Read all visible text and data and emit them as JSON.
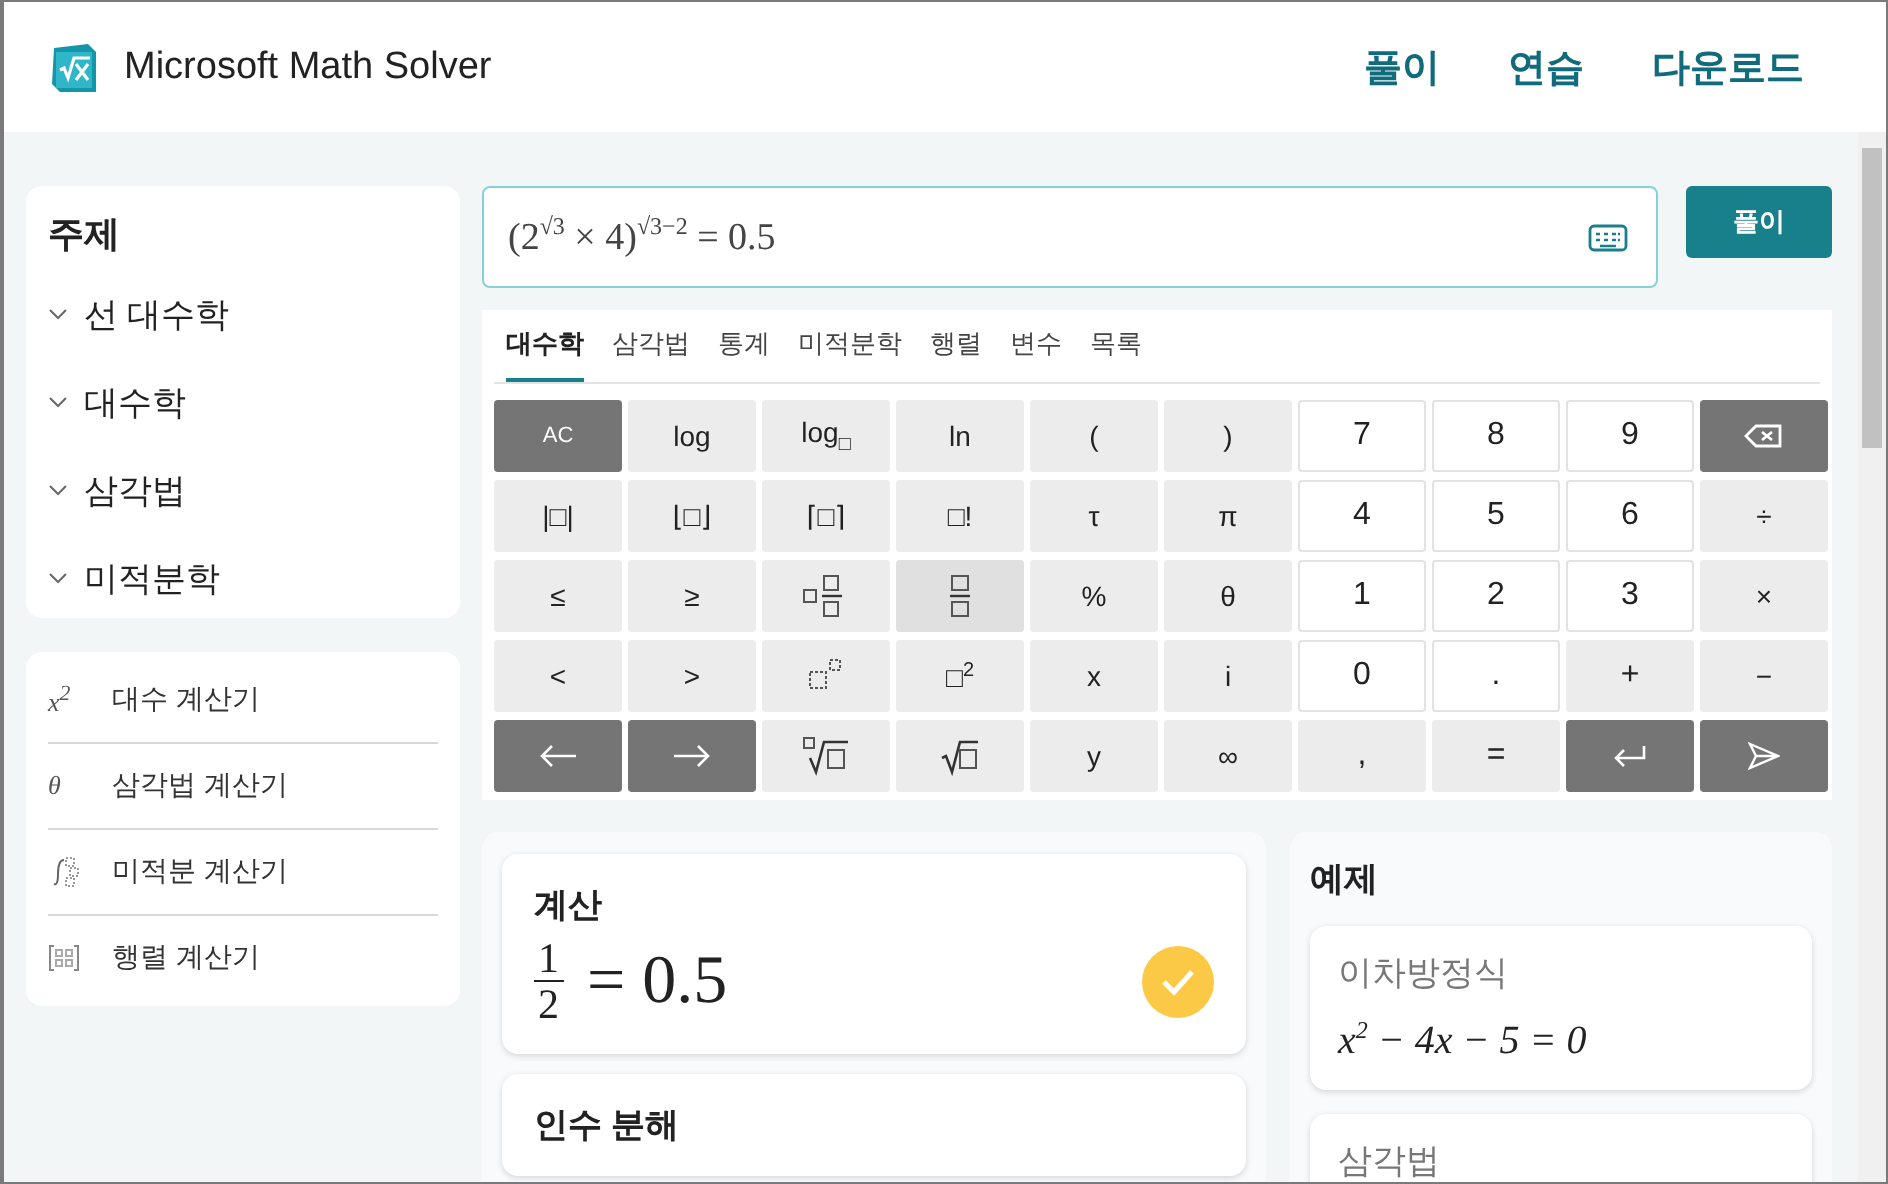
{
  "header": {
    "title": "Microsoft Math Solver",
    "nav": [
      {
        "label": "풀이"
      },
      {
        "label": "연습"
      },
      {
        "label": "다운로드"
      }
    ]
  },
  "sidebar": {
    "heading": "주제",
    "topics": [
      {
        "label": "선 대수학",
        "expanded": false
      },
      {
        "label": "대수학",
        "expanded": false
      },
      {
        "label": "삼각법",
        "expanded": false
      },
      {
        "label": "미적분학",
        "expanded": false
      }
    ],
    "calculators": [
      {
        "symbol": "x$^{2}$",
        "label": "대수 계산기"
      },
      {
        "symbol": "θ",
        "label": "삼각법 계산기"
      },
      {
        "label": "미적분 계산기"
      },
      {
        "label": "행렬 계산기"
      }
    ]
  },
  "input": {
    "value": "(2$^{√3}$ × 4)$^{√3−2}$   = 0.5",
    "button": "풀이"
  },
  "keyboard": {
    "tabs": [
      {
        "label": "대수학",
        "selected": true
      },
      {
        "label": "삼각법",
        "selected": false
      },
      {
        "label": "통계",
        "selected": false
      },
      {
        "label": "미적분학",
        "selected": false
      },
      {
        "label": "행렬",
        "selected": false
      },
      {
        "label": "변수",
        "selected": false
      },
      {
        "label": "목록",
        "selected": false
      }
    ],
    "keys": [
      {
        "label": "AC",
        "kind": "dark"
      },
      {
        "label": "log",
        "kind": "light"
      },
      {
        "label": "log$_{□}$",
        "kind": "light"
      },
      {
        "label": "ln",
        "kind": "light"
      },
      {
        "label": "(",
        "kind": "light"
      },
      {
        "label": ")",
        "kind": "light"
      },
      {
        "label": "7",
        "kind": "white"
      },
      {
        "label": "8",
        "kind": "white"
      },
      {
        "label": "9",
        "kind": "white"
      },
      {
        "kind": "dark"
      },
      {
        "label": "|□|",
        "kind": "light"
      },
      {
        "label": "⌊□⌋",
        "kind": "light"
      },
      {
        "label": "⌈□⌉",
        "kind": "light"
      },
      {
        "label": "□!",
        "kind": "light"
      },
      {
        "label": "τ",
        "kind": "light"
      },
      {
        "label": "π",
        "kind": "light"
      },
      {
        "label": "4",
        "kind": "white"
      },
      {
        "label": "5",
        "kind": "white"
      },
      {
        "label": "6",
        "kind": "white"
      },
      {
        "label": "÷",
        "kind": "light"
      },
      {
        "label": "≤",
        "kind": "light"
      },
      {
        "label": "≥",
        "kind": "light"
      },
      {
        "kind": "light"
      },
      {
        "kind": "pressed"
      },
      {
        "label": "%",
        "kind": "light"
      },
      {
        "label": "θ",
        "kind": "light"
      },
      {
        "label": "1",
        "kind": "white"
      },
      {
        "label": "2",
        "kind": "white"
      },
      {
        "label": "3",
        "kind": "white"
      },
      {
        "label": "×",
        "kind": "light"
      },
      {
        "label": "<",
        "kind": "light"
      },
      {
        "label": ">",
        "kind": "light"
      },
      {
        "kind": "light"
      },
      {
        "label": "□$^{2}$",
        "kind": "light"
      },
      {
        "label": "x",
        "kind": "light"
      },
      {
        "label": "i",
        "kind": "light"
      },
      {
        "label": "0",
        "kind": "white"
      },
      {
        "label": ".",
        "kind": "white"
      },
      {
        "label": "+",
        "kind": "light"
      },
      {
        "label": "−",
        "kind": "light"
      },
      {
        "kind": "dark"
      },
      {
        "kind": "dark"
      },
      {
        "kind": "light"
      },
      {
        "kind": "light"
      },
      {
        "label": "y",
        "kind": "light"
      },
      {
        "label": "∞",
        "kind": "light"
      },
      {
        "label": ",",
        "kind": "light"
      },
      {
        "label": "=",
        "kind": "light"
      },
      {
        "kind": "dark"
      },
      {
        "kind": "dark"
      }
    ]
  },
  "results": [
    {
      "title": "계산",
      "numerator": "1",
      "denominator": "2",
      "value": "= 0.5",
      "verified": true
    },
    {
      "title": "인수 분해"
    }
  ],
  "examples": {
    "heading": "예제",
    "items": [
      {
        "title": "이차방정식",
        "equation": "x$^{2}$ − 4x − 5 = 0"
      },
      {
        "title": "삼각법"
      }
    ]
  }
}
